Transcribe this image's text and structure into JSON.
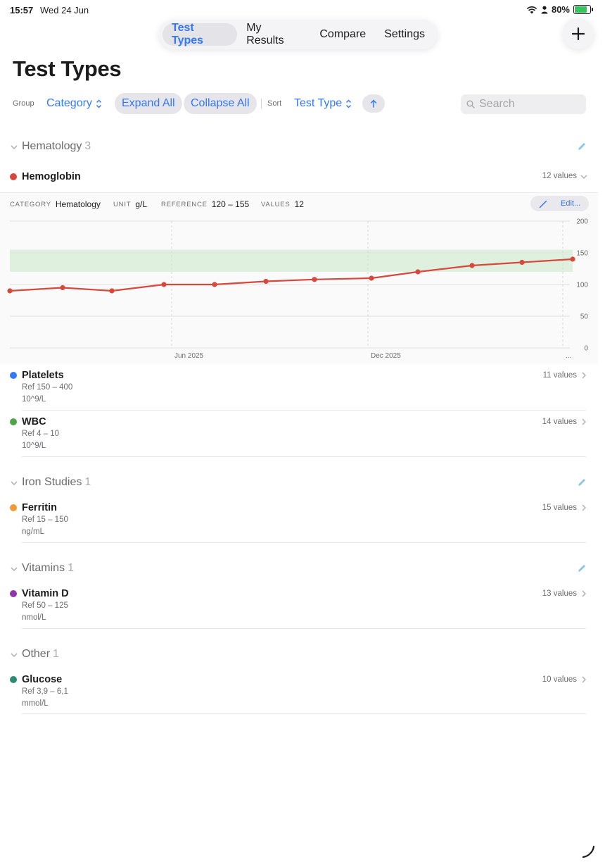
{
  "status": {
    "time": "15:57",
    "date": "Wed 24 Jun",
    "battery": "80%"
  },
  "tabs": [
    {
      "label": "Test Types",
      "active": true
    },
    {
      "label": "My Results",
      "active": false
    },
    {
      "label": "Compare",
      "active": false
    },
    {
      "label": "Settings",
      "active": false
    }
  ],
  "page_title": "Test Types",
  "toolbar": {
    "group_label": "Group",
    "group_value": "Category",
    "expand_all": "Expand All",
    "collapse_all": "Collapse All",
    "sort_label": "Sort",
    "sort_value": "Test Type",
    "search_placeholder": "Search"
  },
  "groups": [
    {
      "name": "Hematology",
      "count": "3",
      "items": [
        {
          "name": "Hemoglobin",
          "color": "#d6483c",
          "values": "12 values",
          "expanded": true
        },
        {
          "name": "Platelets",
          "color": "#3478f6",
          "ref": "Ref 150 – 400",
          "unit": "10^9/L",
          "values": "11 values"
        },
        {
          "name": "WBC",
          "color": "#4ea44a",
          "ref": "Ref 4 – 10",
          "unit": "10^9/L",
          "values": "14 values"
        }
      ]
    },
    {
      "name": "Iron Studies",
      "count": "1",
      "items": [
        {
          "name": "Ferritin",
          "color": "#f09a37",
          "ref": "Ref 15 – 150",
          "unit": "ng/mL",
          "values": "15 values"
        }
      ]
    },
    {
      "name": "Vitamins",
      "count": "1",
      "items": [
        {
          "name": "Vitamin D",
          "color": "#8e35a8",
          "ref": "Ref 50 – 125",
          "unit": "nmol/L",
          "values": "13 values"
        }
      ]
    },
    {
      "name": "Other",
      "count": "1",
      "items": [
        {
          "name": "Glucose",
          "color": "#2f8a73",
          "ref": "Ref 3,9 – 6,1",
          "unit": "mmol/L",
          "values": "10 values"
        }
      ]
    }
  ],
  "detail": {
    "category_key": "CATEGORY",
    "category": "Hematology",
    "unit_key": "UNIT",
    "unit": "g/L",
    "reference_key": "REFERENCE",
    "reference": "120 – 155",
    "values_key": "VALUES",
    "values": "12",
    "edit_label": "Edit..."
  },
  "chart_data": {
    "type": "line",
    "series": [
      {
        "values": [
          90,
          95,
          90,
          100,
          100,
          105,
          108,
          110,
          120,
          130,
          135,
          140
        ]
      }
    ],
    "x_tick_labels": [
      "Jun 2025",
      "Dec 2025",
      "..."
    ],
    "y_ticks": [
      0,
      50,
      100,
      150,
      200
    ],
    "ylim": [
      0,
      200
    ],
    "reference_band": [
      120,
      155
    ],
    "line_color": "#d6483c",
    "band_color": "#dff1de",
    "grid": true
  }
}
